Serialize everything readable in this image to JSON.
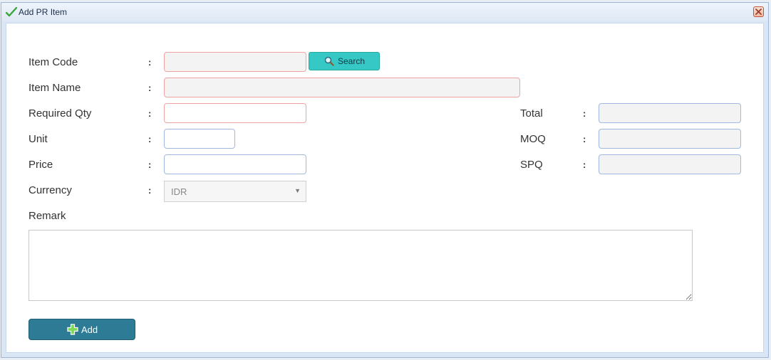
{
  "dialog": {
    "title": "Add PR Item",
    "title_icon": "checkmark-icon",
    "close_icon": "close-icon"
  },
  "colon": ":",
  "form": {
    "item_code": {
      "label": "Item Code",
      "value": ""
    },
    "search_button": {
      "label": "Search",
      "icon": "search-icon"
    },
    "item_name": {
      "label": "Item Name",
      "value": ""
    },
    "required_qty": {
      "label": "Required Qty",
      "value": ""
    },
    "unit": {
      "label": "Unit",
      "value": ""
    },
    "price": {
      "label": "Price",
      "value": ""
    },
    "currency": {
      "label": "Currency",
      "value": "IDR"
    },
    "total": {
      "label": "Total",
      "value": ""
    },
    "moq": {
      "label": "MOQ",
      "value": ""
    },
    "spq": {
      "label": "SPQ",
      "value": ""
    },
    "remark": {
      "label": "Remark",
      "value": ""
    },
    "add_button": {
      "label": "Add",
      "icon": "plus-icon"
    }
  },
  "colors": {
    "search_button": "#35c8c4",
    "add_button": "#2e7b96",
    "required_border": "#f1a3a3",
    "input_border": "#9fb9de"
  }
}
